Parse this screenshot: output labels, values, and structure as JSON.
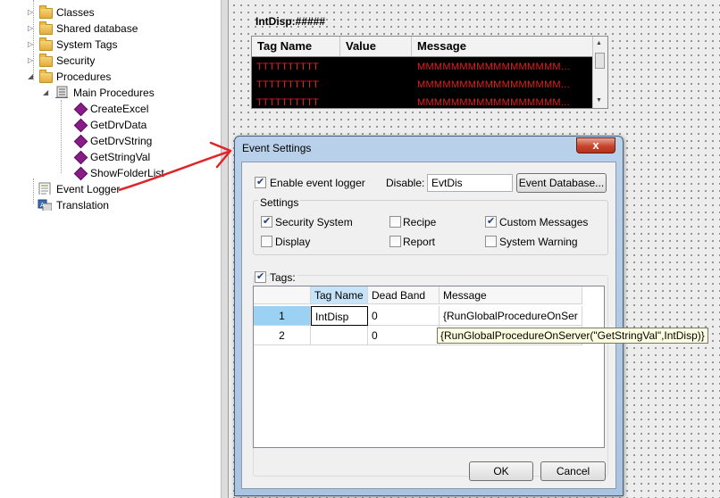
{
  "tree": {
    "items": [
      {
        "label": "Classes"
      },
      {
        "label": "Shared database"
      },
      {
        "label": "System Tags"
      },
      {
        "label": "Security"
      },
      {
        "label": "Procedures"
      },
      {
        "label": "Main Procedures"
      },
      {
        "label": "CreateExcel"
      },
      {
        "label": "GetDrvData"
      },
      {
        "label": "GetDrvString"
      },
      {
        "label": "GetStringVal"
      },
      {
        "label": "ShowFolderList"
      },
      {
        "label": "Event Logger"
      },
      {
        "label": "Translation"
      }
    ]
  },
  "canvas": {
    "intdisp_label": "IntDisp:#####",
    "alarm_grid": {
      "headers": [
        "Tag Name",
        "Value",
        "Message"
      ],
      "rows": [
        {
          "tag": "TTTTTTTTTT",
          "message": "MMMMMMMMMMMMMMMMM..."
        },
        {
          "tag": "TTTTTTTTTT",
          "message": "MMMMMMMMMMMMMMMMM..."
        },
        {
          "tag": "TTTTTTTTTT",
          "message": "MMMMMMMMMMMMMMMMM..."
        }
      ]
    }
  },
  "dialog": {
    "title": "Event Settings",
    "close_glyph": "x",
    "enable_logger": {
      "label": "Enable event logger",
      "checked": true
    },
    "disable_label": "Disable:",
    "disable_value": "EvtDis",
    "event_db_button": "Event Database...",
    "settings_group": "Settings",
    "settings": [
      {
        "label": "Security System",
        "checked": true
      },
      {
        "label": "Recipe",
        "checked": false
      },
      {
        "label": "Custom Messages",
        "checked": true
      },
      {
        "label": "Display",
        "checked": false
      },
      {
        "label": "Report",
        "checked": false
      },
      {
        "label": "System Warning",
        "checked": false
      }
    ],
    "tags": {
      "label": "Tags:",
      "checked": true
    },
    "grid": {
      "headers": [
        "Tag Name",
        "Dead Band",
        "Message"
      ],
      "rows": [
        {
          "num": "1",
          "tag": "IntDisp",
          "dead_band": "0",
          "message": "{RunGlobalProcedureOnSer"
        },
        {
          "num": "2",
          "tag": "",
          "dead_band": "0",
          "message": ""
        }
      ]
    },
    "tooltip": "{RunGlobalProcedureOnServer(\"GetStringVal\",IntDisp)}",
    "ok_button": "OK",
    "cancel_button": "Cancel"
  },
  "colors": {
    "arrow": "#e0242a",
    "alarm_text": "#e02020",
    "selected_header": "#c7e3f7",
    "selected_row_header": "#9bd1f3"
  }
}
